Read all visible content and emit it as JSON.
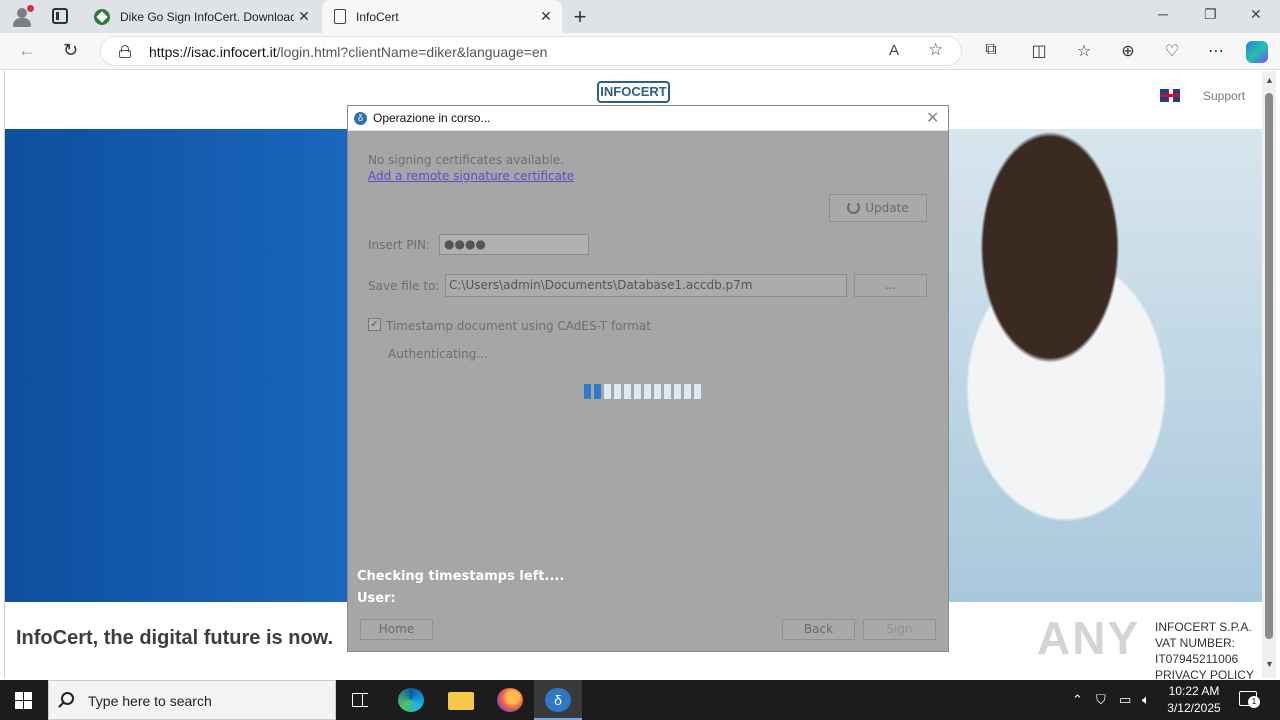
{
  "browser": {
    "tabs": [
      {
        "label": "Dike Go Sign InfoCert. Download"
      },
      {
        "label": "InfoCert"
      }
    ],
    "new_tab": "+",
    "tab_close": "✕",
    "url_domain": "https://isac.infocert.it",
    "url_rest": "/login.html?clientName=diker&language=en",
    "window_controls": {
      "minimize": "─",
      "maximize": "❐",
      "close": "✕"
    }
  },
  "page": {
    "logo": "INFOCERT",
    "support": "Support",
    "tagline": "InfoCert, the digital future is now.",
    "company_name": "INFOCERT S.P.A.",
    "vat": "VAT NUMBER: IT07945211006",
    "privacy": "PRIVACY POLICY",
    "watermark": "ANY"
  },
  "dialog": {
    "title": "Operazione in corso...",
    "close": "✕",
    "no_certificates": "No signing certificates available.",
    "add_link": "Add a remote signature certificate",
    "update_button": "Update",
    "pin_label": "Insert PIN:",
    "pin_value": "●●●●",
    "save_label": "Save file to:",
    "save_value": "C:\\Users\\admin\\Documents\\Database1.accdb.p7m",
    "browse_button": "...",
    "timestamp_checked": true,
    "timestamp_label": "Timestamp document using CAdES-T format",
    "authenticating": "Authenticating...",
    "progress_filled": 2,
    "progress_total": 12,
    "status_line1": "Checking timestamps left....",
    "status_line2": "User:",
    "home_button": "Home",
    "back_button": "Back",
    "sign_button": "Sign"
  },
  "taskbar": {
    "search_placeholder": "Type here to search",
    "time": "10:22 AM",
    "date": "3/12/2025",
    "notification_count": "1"
  },
  "colors": {
    "dialog_bg": "#a6a6a6",
    "progress_on": "#2f7bc7",
    "progress_off": "#dce8f2",
    "hero_blue": "#1a67bd"
  }
}
